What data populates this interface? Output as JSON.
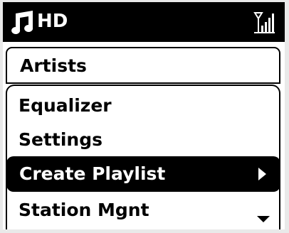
{
  "status_bar": {
    "source_icon": "music-note-icon",
    "source_label": "HD",
    "signal_icon": "signal-strength-icon"
  },
  "menu": {
    "title": "Artists",
    "items": [
      {
        "label": "Equalizer"
      },
      {
        "label": "Settings"
      },
      {
        "label": "Create Playlist",
        "selected": true,
        "indicator": "chevron-right-icon"
      },
      {
        "label": "Station Mgnt"
      }
    ],
    "scroll_indicator": "scroll-down-icon"
  },
  "colors": {
    "background": "#ffffff",
    "foreground": "#000000",
    "highlight": "#000000",
    "highlight_text": "#ffffff"
  }
}
